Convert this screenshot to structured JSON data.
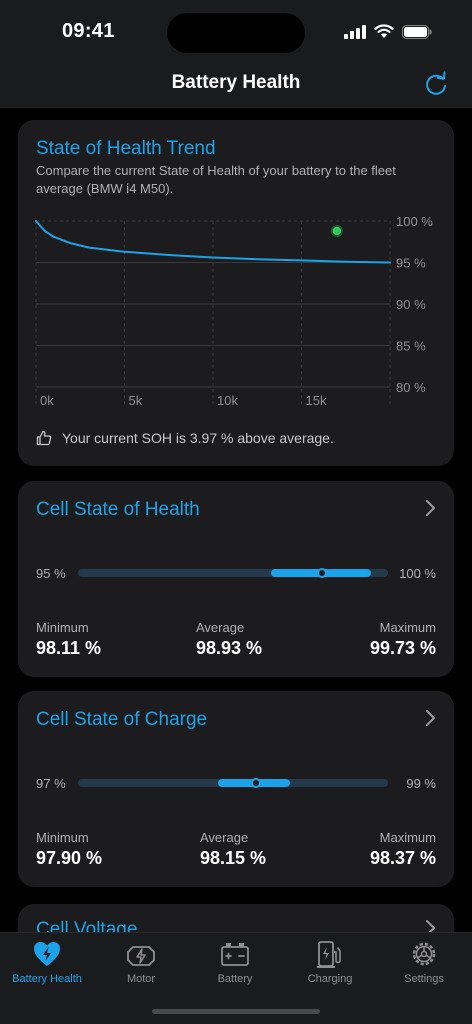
{
  "status_bar": {
    "time": "09:41"
  },
  "nav": {
    "title": "Battery Health"
  },
  "soh_card": {
    "title": "State of Health Trend",
    "description": "Compare the current State of Health of your battery to the fleet average (BMW i4 M50).",
    "note": "Your current SOH is 3.97 % above average."
  },
  "chart_data": {
    "type": "line",
    "x_ticks": [
      "0k",
      "5k",
      "10k",
      "15k"
    ],
    "y_ticks": [
      "100 %",
      "95 %",
      "90 %",
      "85 %",
      "80 %"
    ],
    "ylim": [
      80,
      100
    ],
    "xlim": [
      0,
      20000
    ],
    "grid": true,
    "series": [
      {
        "values_x": [
          0,
          500,
          1000,
          2000,
          3000,
          5000,
          7500,
          10000,
          12500,
          15000,
          17500,
          20000
        ],
        "values_y": [
          100,
          98.8,
          98.1,
          97.3,
          96.8,
          96.3,
          95.9,
          95.6,
          95.4,
          95.25,
          95.1,
          95.0
        ]
      }
    ],
    "current_point": {
      "x": 17000,
      "y": 98.8
    },
    "colors": {
      "line": "#1aa3e8",
      "point": "#34c759"
    }
  },
  "cell_soh": {
    "title": "Cell State of Health",
    "range_min_label": "95 %",
    "range_max_label": "100 %",
    "range_min": 95,
    "range_max": 100,
    "minimum_label": "Minimum",
    "minimum": "98.11 %",
    "minimum_value": 98.11,
    "average_label": "Average",
    "average": "98.93 %",
    "average_value": 98.93,
    "maximum_label": "Maximum",
    "maximum": "99.73 %",
    "maximum_value": 99.73
  },
  "cell_soc": {
    "title": "Cell State of Charge",
    "range_min_label": "97 %",
    "range_max_label": "99 %",
    "range_min": 97,
    "range_max": 99,
    "minimum_label": "Minimum",
    "minimum": "97.90 %",
    "minimum_value": 97.9,
    "average_label": "Average",
    "average": "98.15 %",
    "average_value": 98.15,
    "maximum_label": "Maximum",
    "maximum": "98.37 %",
    "maximum_value": 98.37
  },
  "cell_voltage": {
    "title": "Cell Voltage"
  },
  "tabs": [
    {
      "label": "Battery Health",
      "icon": "heart-bolt-icon",
      "active": true
    },
    {
      "label": "Motor",
      "icon": "motor-icon",
      "active": false
    },
    {
      "label": "Battery",
      "icon": "battery-icon",
      "active": false
    },
    {
      "label": "Charging",
      "icon": "ev-charger-icon",
      "active": false
    },
    {
      "label": "Settings",
      "icon": "gear-icon",
      "active": false
    }
  ],
  "colors": {
    "accent": "#1aa3e8",
    "background": "#000000",
    "card": "#1c1c1e"
  }
}
